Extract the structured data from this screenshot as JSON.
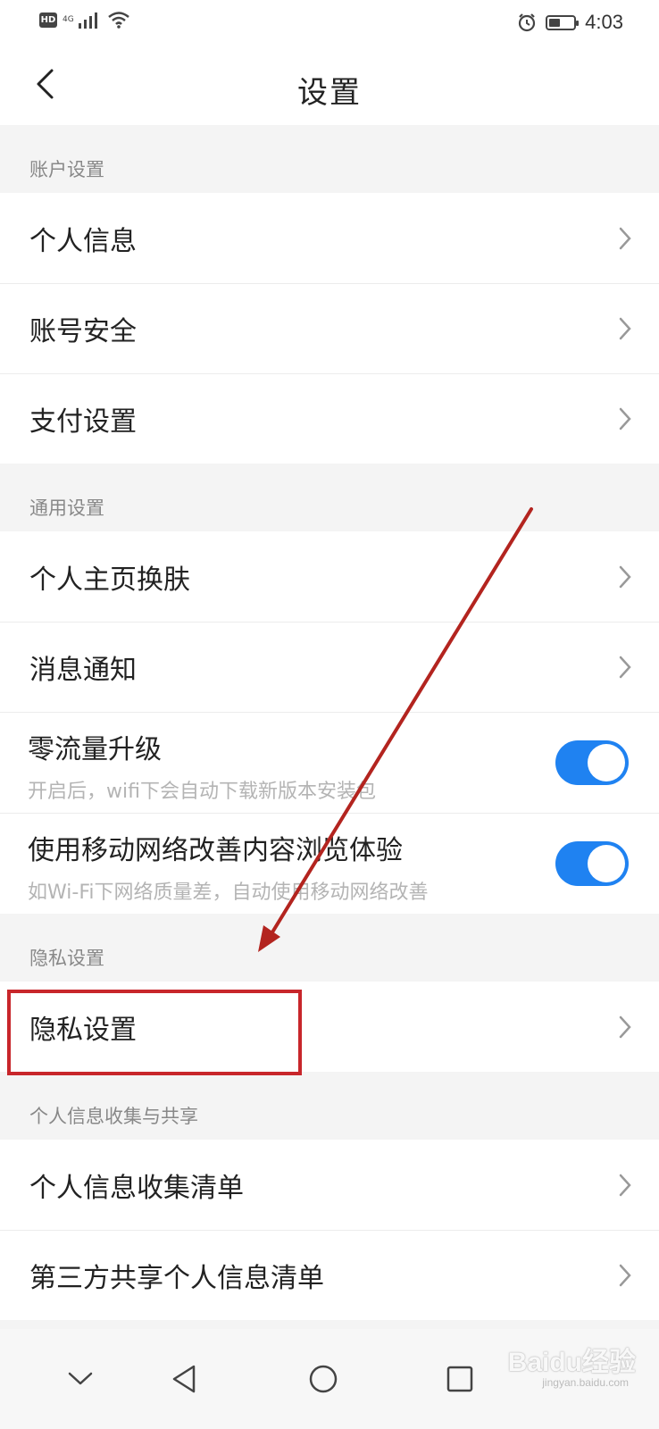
{
  "status_bar": {
    "badge": "HD",
    "network": "4G",
    "time": "4:03",
    "battery_level": 0.45,
    "icons": [
      "hd-icon",
      "signal-icon",
      "wifi-icon",
      "alarm-icon",
      "battery-icon"
    ]
  },
  "header": {
    "title": "设置",
    "back_icon": "chevron-left-icon"
  },
  "sections": {
    "account": {
      "heading": "账户设置",
      "items": [
        "个人信息",
        "账号安全",
        "支付设置"
      ]
    },
    "general": {
      "heading": "通用设置",
      "items": [
        "个人主页换肤",
        "消息通知"
      ],
      "toggles": [
        {
          "label": "零流量升级",
          "description": "开启后，wifi下会自动下载新版本安装包",
          "on": true
        },
        {
          "label": "使用移动网络改善内容浏览体验",
          "description": "如Wi-Fi下网络质量差，自动使用移动网络改善",
          "on": true
        }
      ]
    },
    "privacy": {
      "heading": "隐私设置",
      "items": [
        "隐私设置"
      ]
    },
    "info_sharing": {
      "heading": "个人信息收集与共享",
      "items": [
        "个人信息收集清单",
        "第三方共享个人信息清单"
      ]
    }
  },
  "nav_bar": {
    "icons": [
      "collapse-chevron-icon",
      "back-triangle-icon",
      "home-circle-icon",
      "recents-square-icon"
    ]
  },
  "annotation": {
    "highlight_color": "#c8262b",
    "arrow_color": "#b3241f"
  },
  "watermark": {
    "text": "Baidu经验",
    "sub": "jingyan.baidu.com"
  },
  "colors": {
    "toggle_on": "#1f82f1",
    "page_bg": "#f4f4f4",
    "section_text": "#888888",
    "sub_text": "#b4b4b4"
  }
}
